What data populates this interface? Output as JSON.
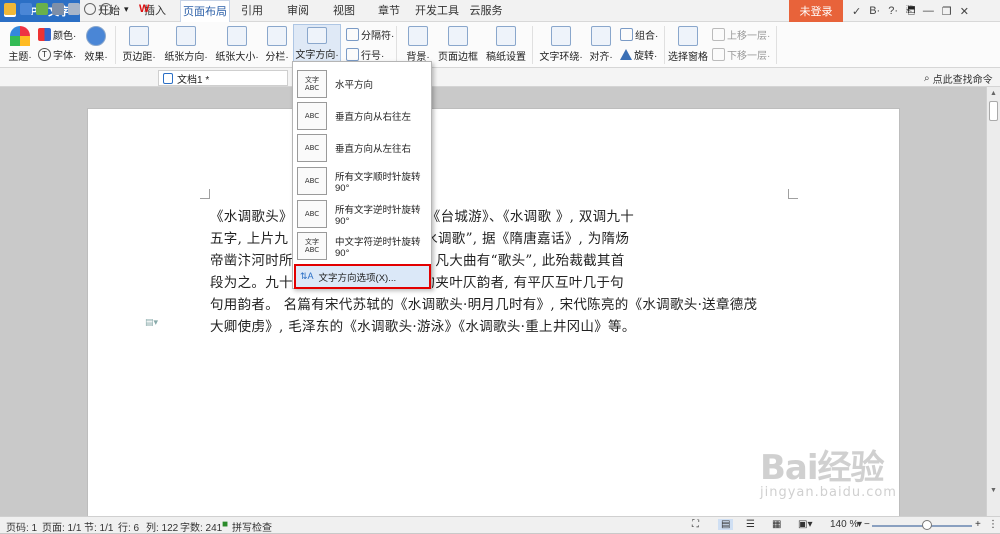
{
  "app": {
    "title": "WPS 文字",
    "logo": "W"
  },
  "menu_tabs": [
    "开始",
    "插入",
    "页面布局",
    "引用",
    "审阅",
    "视图",
    "章节",
    "开发工具",
    "云服务"
  ],
  "active_tab": "页面布局",
  "login_label": "未登录",
  "titlebar_icons": [
    "✓",
    "B·",
    "?·",
    "⎗",
    "—",
    "❐",
    "✕"
  ],
  "ribbon": {
    "theme_label": "主题·",
    "color_label": "颜色·",
    "font_label": "字体·",
    "effect_label": "效果·",
    "margin_label": "页边距·",
    "orientation_label": "纸张方向·",
    "size_label": "纸张大小·",
    "columns_label": "分栏·",
    "text_direction_label": "文字方向·",
    "separator_label": "分隔符·",
    "line_number_label": "行号·",
    "background_label": "背景·",
    "border_label": "页面边框",
    "draft_label": "稿纸设置",
    "wrap_label": "文字环绕·",
    "align_label": "对齐·",
    "group_label": "组合·",
    "rotate_label": "旋转·",
    "pane_label": "选择窗格",
    "forward_label": "上移一层·",
    "backward_label": "下移一层·"
  },
  "quickbar": {
    "doc_tab": "文档1 *",
    "search_cmd": "点此查找命令"
  },
  "dropdown": {
    "items": [
      {
        "icon_text": "文字ABC",
        "label": "水平方向"
      },
      {
        "icon_text": "ABC",
        "label": "垂直方向从右往左"
      },
      {
        "icon_text": "ABC",
        "label": "垂直方向从左往右"
      },
      {
        "icon_text": "ABC",
        "label": "所有文字顺时针旋转90°"
      },
      {
        "icon_text": "ABC",
        "label": "所有文字逆时针旋转90°"
      },
      {
        "icon_text": "文字ABC",
        "label": "中文字符逆时针旋转90°"
      }
    ],
    "option_label": "文字方向选项(X)..."
  },
  "document": {
    "lines": [
      "《水调歌头》, 《元会曲》、《凯歌》、《台城游》、《水调歌 》, 双调九十",
      "五字, 上片九 四平韵。唐朝大曲有“水调歌”, 据《隋唐嘉话》, 为隋炀",
      "帝凿汴河时所 见《碧鸡漫志》卷四。凡大曲有“歌头”, 此殆裁截其首",
      "段为之。九十 。亦有前后片两六言句夹叶仄韵者, 有平仄互叶几于句",
      "句用韵者。 名篇有宋代苏轼的《水调歌头·明月几时有》, 宋代陈亮的《水调歌头·送章德茂",
      "大卿使虏》, 毛泽东的《水调歌头·游泳》《水调歌头·重上井冈山》等。"
    ]
  },
  "statusbar": {
    "page_code": "页码: 1",
    "page": "页面: 1/1",
    "section": "节: 1/1",
    "row": "行: 6",
    "col": "列: 122",
    "words": "字数: 241",
    "spell": "拼写检查",
    "zoom": "140 %"
  },
  "watermark": {
    "logo": "Bai经验",
    "sub": "jingyan.baidu.com"
  },
  "colors": {
    "accent": "#2b6fc5",
    "login": "#e8633a",
    "highlight_border": "#e30000"
  }
}
